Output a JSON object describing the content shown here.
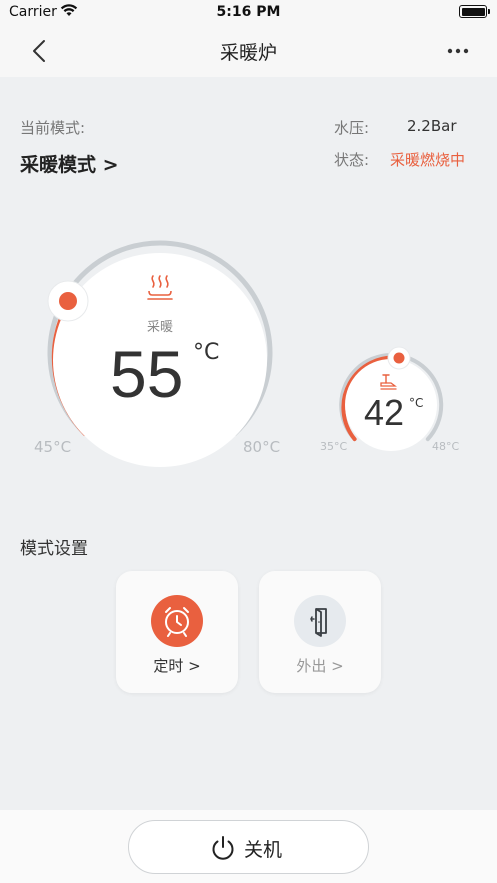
{
  "status_bar": {
    "carrier": "Carrier",
    "time": "5:16 PM"
  },
  "nav": {
    "title": "采暖炉"
  },
  "info": {
    "current_mode_label": "当前模式:",
    "current_mode_value": "采暖模式 >",
    "pressure_label": "水压:",
    "pressure_value": "2.2Bar",
    "state_label": "状态:",
    "state_value": "采暖燃烧中"
  },
  "heating_gauge": {
    "label": "采暖",
    "value": "55",
    "unit": "°C",
    "min": "45°C",
    "max": "80°C"
  },
  "water_gauge": {
    "value": "42",
    "unit": "°C",
    "min": "35°C",
    "max": "48°C"
  },
  "mode_settings": {
    "title": "模式设置",
    "timer_label": "定时 >",
    "away_label": "外出 >"
  },
  "power": {
    "label": "关机"
  },
  "colors": {
    "accent": "#e9603f",
    "track": "#c9ced2"
  }
}
